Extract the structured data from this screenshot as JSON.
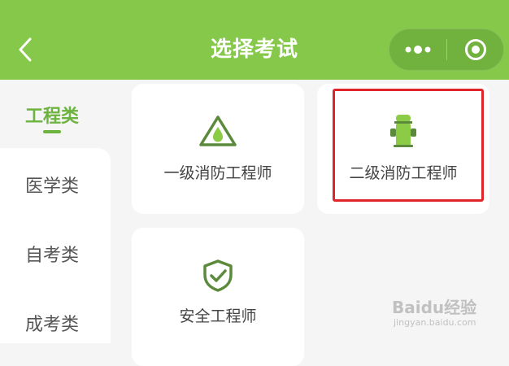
{
  "header": {
    "title": "选择考试",
    "back_icon": "chevron-left-icon",
    "more_icon": "more-dots-icon",
    "close_icon": "target-circle-icon",
    "bar_color": "#86c94a"
  },
  "sidebar": {
    "items": [
      {
        "label": "工程类",
        "active": true
      },
      {
        "label": "医学类",
        "active": false
      },
      {
        "label": "自考类",
        "active": false
      },
      {
        "label": "成考类",
        "active": false
      }
    ],
    "accent_color": "#6cb33f"
  },
  "exams": [
    {
      "label": "一级消防工程师",
      "icon": "flame-triangle-icon"
    },
    {
      "label": "二级消防工程师",
      "icon": "fire-hydrant-icon",
      "highlighted": true
    },
    {
      "label": "安全工程师",
      "icon": "shield-check-icon"
    }
  ],
  "highlight_color": "#e0242a",
  "watermark": {
    "main": "Baidu经验",
    "sub": "jingyan.baidu.com"
  }
}
